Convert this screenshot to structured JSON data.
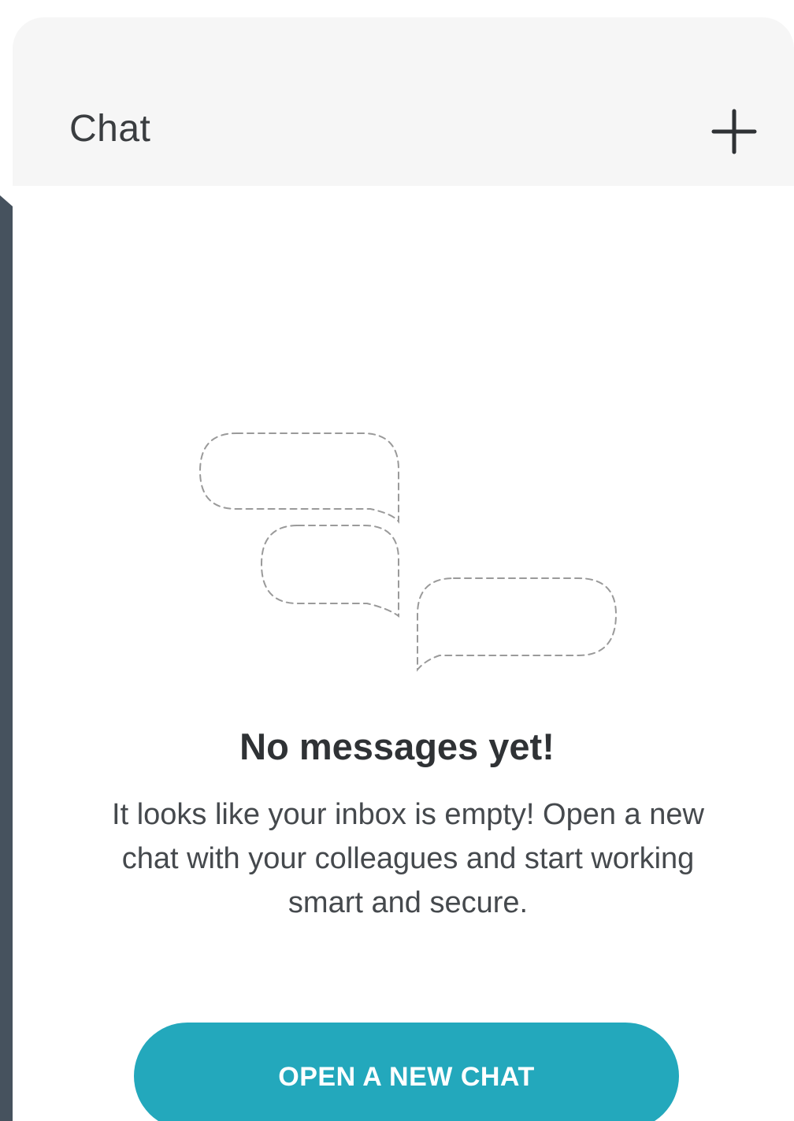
{
  "header": {
    "title": "Chat",
    "add_icon": "plus-icon"
  },
  "empty_state": {
    "illustration_icon": "chat-bubbles-icon",
    "title": "No messages yet!",
    "body": "It looks like your inbox is empty! Open a new chat with your colleagues and start working smart and secure.",
    "cta_label": "OPEN A NEW CHAT"
  },
  "colors": {
    "accent": "#23a8bc",
    "header_bg": "#f6f6f6",
    "frame": "#46525e",
    "text_primary": "#2f3235",
    "text_secondary": "#45494d"
  }
}
